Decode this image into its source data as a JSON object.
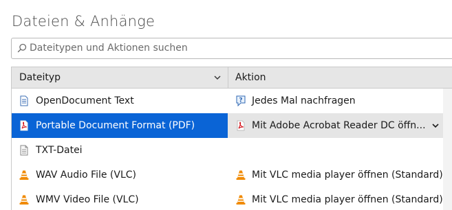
{
  "section": {
    "title": "Dateien & Anhänge"
  },
  "search": {
    "placeholder": "Dateitypen und Aktionen suchen",
    "icon": "search-icon"
  },
  "table": {
    "columns": [
      "Dateityp",
      "Aktion"
    ],
    "rows": [
      {
        "type": "OpenDocument Text",
        "type_icon": "document-icon",
        "action": "Jedes Mal nachfragen",
        "action_icon": "question-icon",
        "selected": false
      },
      {
        "type": "Portable Document Format (PDF)",
        "type_icon": "pdf-icon",
        "action": "Mit Adobe Acrobat Reader DC öffn...",
        "action_icon": "acrobat-icon",
        "selected": true
      },
      {
        "type": "TXT-Datei",
        "type_icon": "text-file-icon",
        "action": "",
        "action_icon": "",
        "selected": false
      },
      {
        "type": "WAV Audio File (VLC)",
        "type_icon": "vlc-icon",
        "action": "Mit VLC media player öffnen (Standard)",
        "action_icon": "vlc-icon",
        "selected": false
      },
      {
        "type": "WMV Video File (VLC)",
        "type_icon": "vlc-icon",
        "action": "Mit VLC media player öffnen (Standard)",
        "action_icon": "vlc-icon",
        "selected": false
      }
    ]
  },
  "colors": {
    "selection": "#0a64d6",
    "header_bg": "#e6e6e6",
    "title": "#4a4a4a"
  }
}
